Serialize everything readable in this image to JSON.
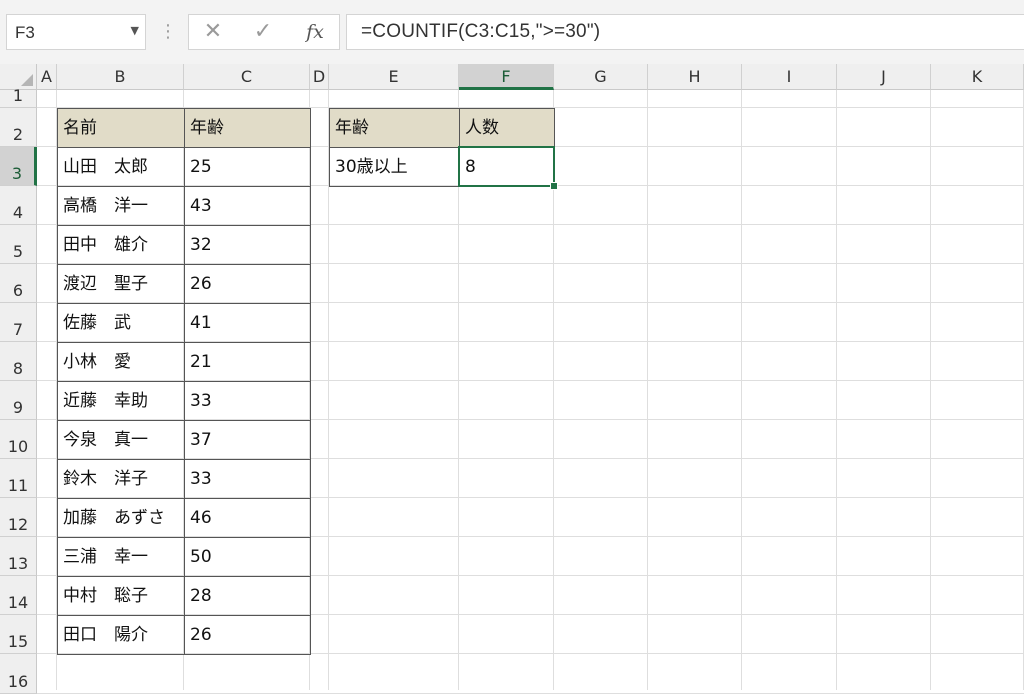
{
  "formula_bar": {
    "name_box": "F3",
    "dots": "⋮",
    "cancel_symbol": "✕",
    "enter_symbol": "✓",
    "fx_symbol": "fx",
    "formula": "=COUNTIF(C3:C15,\">=30\")"
  },
  "columns": [
    "A",
    "B",
    "C",
    "D",
    "E",
    "F",
    "G",
    "H",
    "I",
    "J",
    "K"
  ],
  "rows": [
    "1",
    "2",
    "3",
    "4",
    "5",
    "6",
    "7",
    "8",
    "9",
    "10",
    "11",
    "12",
    "13",
    "14",
    "15",
    "16"
  ],
  "selected_cell": "F3",
  "table1": {
    "headers": [
      "名前",
      "年齢"
    ],
    "rows": [
      [
        "山田　太郎",
        "25"
      ],
      [
        "高橋　洋一",
        "43"
      ],
      [
        "田中　雄介",
        "32"
      ],
      [
        "渡辺　聖子",
        "26"
      ],
      [
        "佐藤　武",
        "41"
      ],
      [
        "小林　愛",
        "21"
      ],
      [
        "近藤　幸助",
        "33"
      ],
      [
        "今泉　真一",
        "37"
      ],
      [
        "鈴木　洋子",
        "33"
      ],
      [
        "加藤　あずさ",
        "46"
      ],
      [
        "三浦　幸一",
        "50"
      ],
      [
        "中村　聡子",
        "28"
      ],
      [
        "田口　陽介",
        "26"
      ]
    ]
  },
  "table2": {
    "headers": [
      "年齢",
      "人数"
    ],
    "row": [
      "30歳以上",
      "8"
    ]
  },
  "colors": {
    "header_fill": "#e1dcc8",
    "accent": "#217346"
  }
}
